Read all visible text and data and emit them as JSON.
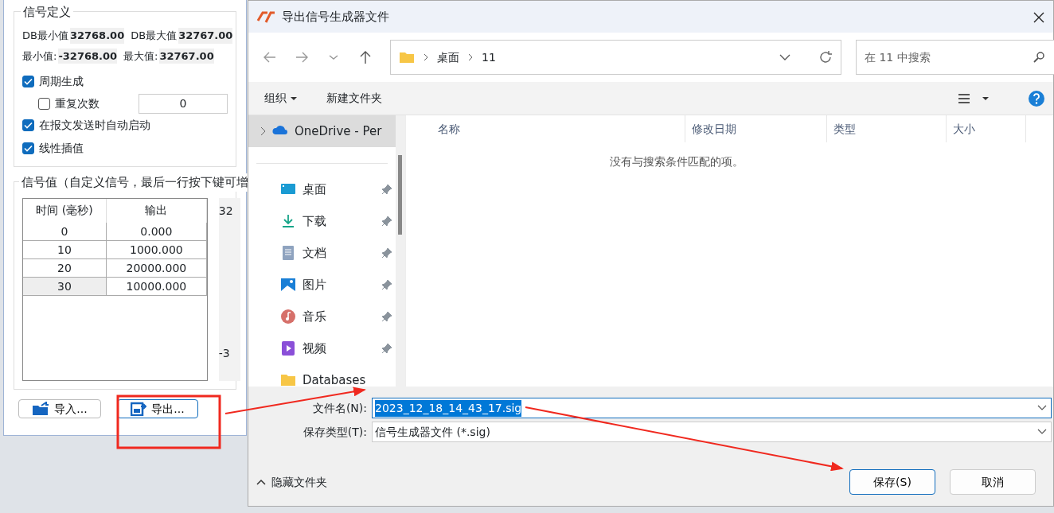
{
  "signal_window": {
    "definition": {
      "title": "信号定义",
      "limits": [
        {
          "label": "DB最小值",
          "value": "32768.00"
        },
        {
          "label": "DB最大值",
          "value": "32767.00"
        },
        {
          "label": "最小值:",
          "value": "-32768.00"
        },
        {
          "label": "最大值:",
          "value": "32767.00"
        }
      ],
      "options": [
        {
          "label": "周期生成",
          "checked": true,
          "children": [
            {
              "label": "重复次数",
              "checked": false,
              "value": "0"
            }
          ]
        },
        {
          "label": "在报文发送时自动启动",
          "checked": true
        },
        {
          "label": "线性插值",
          "checked": true
        }
      ]
    },
    "values": {
      "title": "信号值（自定义信号，最后一行按下键可增",
      "columns": [
        "时间 (毫秒)",
        "输出"
      ],
      "rows": [
        {
          "cells": [
            "0",
            "0.000"
          ],
          "selected": false
        },
        {
          "cells": [
            "10",
            "1000.000"
          ],
          "selected": false
        },
        {
          "cells": [
            "20",
            "20000.000"
          ],
          "selected": false
        },
        {
          "cells": [
            "30",
            "10000.000"
          ],
          "selected": true
        }
      ],
      "chart_labels": [
        "32",
        "-3"
      ]
    },
    "buttons": [
      {
        "label": "导入...",
        "kind": "import",
        "focused": false
      },
      {
        "label": "导出...",
        "kind": "export",
        "focused": true
      }
    ]
  },
  "dialog": {
    "title": "导出信号生成器文件",
    "breadcrumb": [
      "桌面",
      "11"
    ],
    "search": {
      "placeholder": "在 11 中搜索"
    },
    "toolbar": [
      {
        "label": "组织",
        "dropdown": true
      },
      {
        "label": "新建文件夹",
        "dropdown": false
      }
    ],
    "sidebar": [
      {
        "label": "OneDrive - Per",
        "kind": "cloud",
        "selected": true,
        "pinned": false
      },
      {
        "label": "桌面",
        "kind": "desktop",
        "selected": false,
        "pinned": true
      },
      {
        "label": "下载",
        "kind": "download",
        "selected": false,
        "pinned": true
      },
      {
        "label": "文档",
        "kind": "document",
        "selected": false,
        "pinned": true
      },
      {
        "label": "图片",
        "kind": "picture",
        "selected": false,
        "pinned": true
      },
      {
        "label": "音乐",
        "kind": "music",
        "selected": false,
        "pinned": true
      },
      {
        "label": "视频",
        "kind": "video",
        "selected": false,
        "pinned": true
      },
      {
        "label": "Databases",
        "kind": "folder",
        "selected": false,
        "pinned": false
      }
    ],
    "columns": [
      "名称",
      "修改日期",
      "类型",
      "大小"
    ],
    "empty_message": "没有与搜索条件匹配的项。",
    "file_name": {
      "label": "文件名(N):",
      "value": "2023_12_18_14_43_17.sig"
    },
    "file_type": {
      "label": "保存类型(T):",
      "value": "信号生成器文件 (*.sig)"
    },
    "hide_folders": "隐藏文件夹",
    "buttons": [
      {
        "label": "保存(S)",
        "primary": true
      },
      {
        "label": "取消",
        "primary": false
      }
    ]
  }
}
